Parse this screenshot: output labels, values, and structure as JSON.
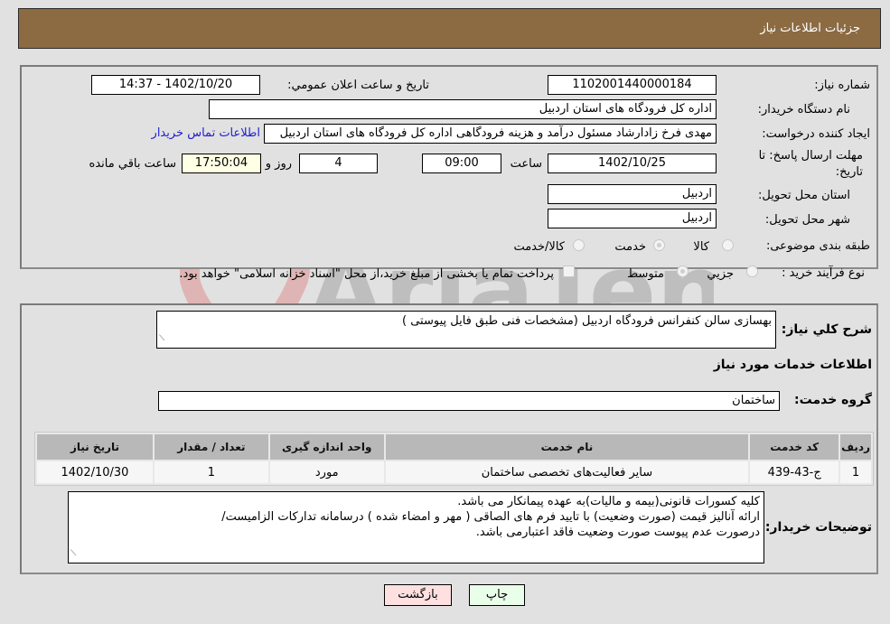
{
  "header": {
    "title": "جزئیات اطلاعات نیاز"
  },
  "details": {
    "need_number_label": "شماره نیاز:",
    "need_number": "1102001440000184",
    "announce_label": "تاریخ و ساعت اعلان عمومي:",
    "announce_value": "1402/10/20 - 14:37",
    "buyer_org_label": "نام دستگاه خریدار:",
    "buyer_org": "اداره کل فرودگاه های استان اردبیل",
    "creator_label": "ایجاد کننده درخواست:",
    "creator": "مهدی فرخ زادارشاد مسئول درآمد و هزینه فرودگاهی اداره کل فرودگاه های استان اردبیل",
    "contact_link": "اطلاعات تماس خریدار",
    "deadline_label": "مهلت ارسال پاسخ: تا تاریخ:",
    "deadline_date": "1402/10/25",
    "time_label": "ساعت",
    "deadline_time": "09:00",
    "days_value": "4",
    "days_label": "روز و",
    "remaining_time": "17:50:04",
    "remaining_label": "ساعت باقي مانده",
    "province_label": "استان محل تحویل:",
    "province": "اردبیل",
    "city_label": "شهر محل تحویل:",
    "city": "اردبیل",
    "category_label": "طبقه بندی موضوعی:",
    "category_options": [
      "کالا",
      "خدمت",
      "کالا/خدمت"
    ],
    "category_selected": "خدمت",
    "process_label": "نوع فرآیند خرید :",
    "process_options": [
      "جزيي",
      "متوسط"
    ],
    "process_selected": "متوسط",
    "payment_note": "پرداخت تمام یا بخشی از مبلغ خرید،از محل \"اسناد خزانه اسلامی\" خواهد بود."
  },
  "description": {
    "label": "شرح کلي نياز:",
    "value": "بهسازی سالن کنفرانس فرودگاه اردبیل (مشخصات فنی طبق فایل پیوستی )"
  },
  "services": {
    "section_title": "اطلاعات خدمات مورد نیاز",
    "group_label": "گروه خدمت:",
    "group_value": "ساختمان",
    "columns": [
      "ردیف",
      "کد خدمت",
      "نام خدمت",
      "واحد اندازه گیری",
      "تعداد / مقدار",
      "تاریخ نیاز"
    ],
    "rows": [
      {
        "row": "1",
        "code": "ج-43-439",
        "name": "سایر فعالیت‌های تخصصی ساختمان",
        "unit": "مورد",
        "qty": "1",
        "date": "1402/10/30"
      }
    ]
  },
  "buyer_notes": {
    "label": "توضیحات خریدار:",
    "lines": [
      "کلیه کسورات قانونی(بیمه و مالیات)به عهده پیمانکار می باشد.",
      "ارائه آنالیز قیمت (صورت وضعیت) با تایید فرم های الصاقی ( مهر و امضاء شده ) درسامانه تدارکات الزامیست/",
      "درصورت عدم پیوست صورت وضعیت فاقد اعتبارمی باشد."
    ]
  },
  "buttons": {
    "print": "چاپ",
    "back": "بازگشت"
  },
  "watermark": {
    "text": "AriaTender.neT"
  },
  "colors": {
    "header_bg": "#8c6b42",
    "link": "#2020d0",
    "back_btn": "#ffe0e0",
    "print_btn": "#eaffea",
    "watermark_red": "#d9534f"
  }
}
